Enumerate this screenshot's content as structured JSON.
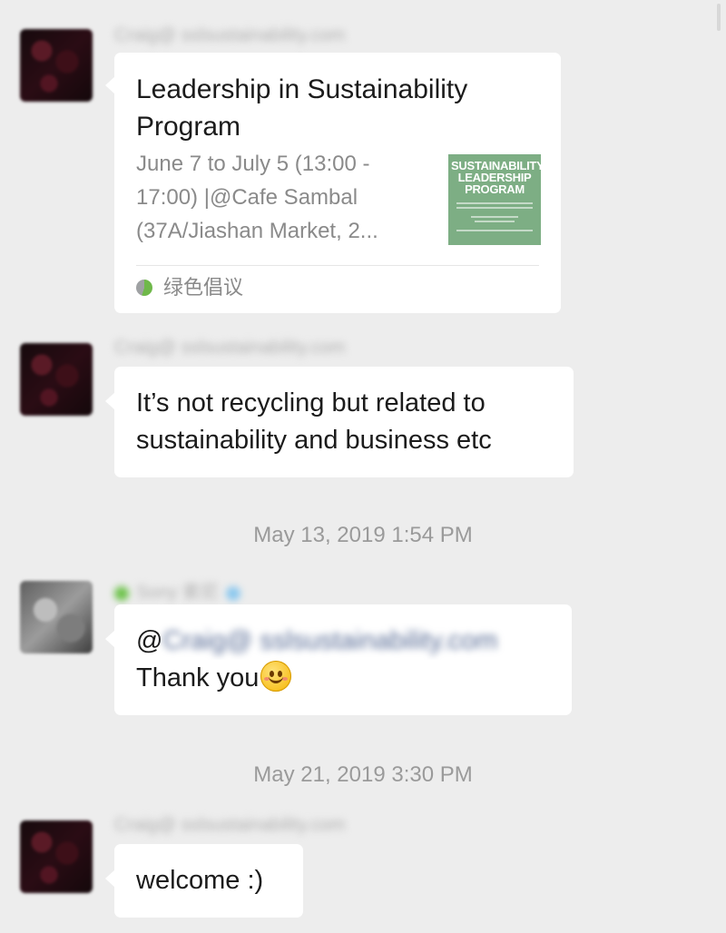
{
  "messages": [
    {
      "sender": "Craig@ sslsustainability.com",
      "card": {
        "title": "Leadership in Sustainability Program",
        "description": "June 7 to July 5 (13:00 - 17:00) |@Cafe Sambal (37A/Jiashan Market, 2...",
        "thumbnail_title": "SUSTAINABILITY LEADERSHIP PROGRAM",
        "source": "绿色倡议",
        "thumb_color": "#7dae84"
      }
    },
    {
      "sender": "Craig@ sslsustainability.com",
      "text": "It’s not recycling but related to sustainability and business etc"
    },
    {
      "timestamp": "May 13, 2019 1:54 PM"
    },
    {
      "sender": "Sony 索尼",
      "mention_prefix": "@",
      "mention_name": "Craig@ sslsustainability.com",
      "text": "Thank you",
      "emoji": "smile-emoji"
    },
    {
      "timestamp": "May 21, 2019 3:30 PM"
    },
    {
      "sender": "Craig@ sslsustainability.com",
      "text": "welcome :)"
    }
  ],
  "colors": {
    "background": "#ededed",
    "bubble": "#ffffff",
    "timestamp": "#9a9a9a",
    "link": "#576b95"
  }
}
